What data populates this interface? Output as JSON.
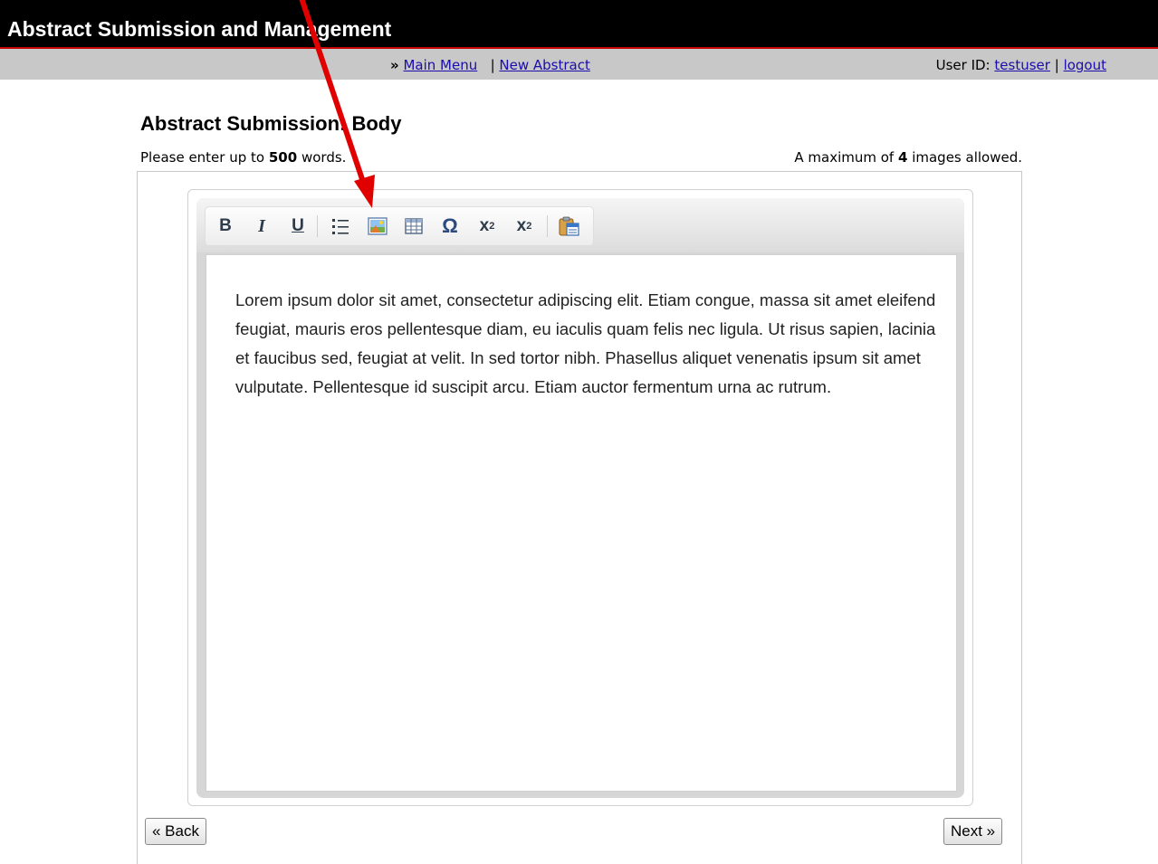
{
  "header": {
    "title": "Abstract Submission and Management"
  },
  "nav": {
    "prefix": "»",
    "main_menu": "Main Menu",
    "separator": "|",
    "new_abstract": "New Abstract",
    "user_label": "User ID:",
    "username": "testuser",
    "logout": "logout"
  },
  "page": {
    "title": "Abstract Submission: Body",
    "words_prefix": "Please enter up to",
    "words_limit": "500",
    "words_suffix": "words.",
    "images_prefix": "A maximum of",
    "images_limit": "4",
    "images_suffix": "images allowed."
  },
  "toolbar": {
    "bold": "B",
    "italic": "I",
    "underline": "U",
    "special_char": "Ω",
    "superscript": "x",
    "superscript_mark": "2",
    "subscript": "x",
    "subscript_mark": "2"
  },
  "editor": {
    "text": "Lorem ipsum dolor sit amet, consectetur adipiscing elit. Etiam congue, massa sit amet eleifend feugiat, mauris eros pellentesque diam, eu iaculis quam felis nec ligula. Ut risus sapien, lacinia et faucibus sed, feugiat at velit. In sed tortor nibh. Phasellus aliquet venenatis ipsum sit amet vulputate. Pellentesque id suscipit arcu. Etiam auctor fermentum urna ac rutrum."
  },
  "buttons": {
    "back": "« Back",
    "next": "Next »"
  },
  "colors": {
    "header_bg": "#000000",
    "header_rule": "#c40000",
    "nav_bg": "#c8c8c8",
    "link": "#1a0dab",
    "annotation_arrow": "#e00000"
  }
}
